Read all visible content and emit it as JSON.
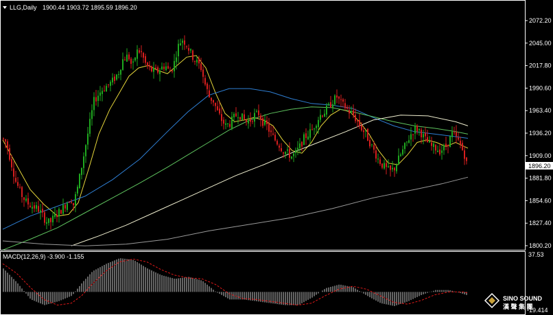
{
  "header": {
    "triangle_icon": "dropdown-triangle-icon",
    "symbol": "LLG,Daily",
    "ohlc": "1900.44 1903.72 1895.59 1896.20"
  },
  "macd_header": "MACD(12,26,9) -3.900 -1.155",
  "price_axis": {
    "ticks": [
      "2072.20",
      "2045.00",
      "2017.80",
      "1990.60",
      "1963.40",
      "1936.20",
      "1909.00",
      "1881.80",
      "1854.60",
      "1827.40",
      "1800.20"
    ],
    "tick_values": [
      2072.2,
      2045.0,
      2017.8,
      1990.6,
      1963.4,
      1936.2,
      1909.0,
      1881.8,
      1854.6,
      1827.4,
      1800.2
    ],
    "current_price": "1896.20",
    "current_value": 1896.2
  },
  "macd_axis": {
    "top": "37.53",
    "bottom": "-19.414",
    "top_value": 37.53,
    "bottom_value": -19.414
  },
  "watermark": {
    "line1": "SINO SOUND",
    "line2": "漢 聲 集 團"
  },
  "colors": {
    "background": "#000000",
    "bull": "#1fa91f",
    "bear": "#d51e1e",
    "ma_fast": "#e6d63a",
    "ma_blue": "#2f7fd4",
    "ma_green": "#5fc45f",
    "ma_white": "#f0efd0",
    "ma_gray": "#9a9a9a",
    "macd_hist": "#c8c8c8",
    "macd_signal": "#e01818",
    "grid_line": "#ffffff"
  },
  "chart_data": {
    "type": "candlestick",
    "symbol": "LLG",
    "timeframe": "Daily",
    "ylim": [
      1800.2,
      2072.2
    ],
    "waypoints": [
      [
        0,
        1930
      ],
      [
        6,
        1925
      ],
      [
        12,
        1905
      ],
      [
        20,
        1878
      ],
      [
        28,
        1862
      ],
      [
        36,
        1852
      ],
      [
        44,
        1848
      ],
      [
        52,
        1845
      ],
      [
        58,
        1838
      ],
      [
        64,
        1830
      ],
      [
        70,
        1828
      ],
      [
        76,
        1835
      ],
      [
        82,
        1840
      ],
      [
        88,
        1845
      ],
      [
        94,
        1852
      ],
      [
        100,
        1858
      ],
      [
        104,
        1850
      ],
      [
        110,
        1870
      ],
      [
        118,
        1905
      ],
      [
        126,
        1940
      ],
      [
        134,
        1975
      ],
      [
        142,
        1985
      ],
      [
        150,
        1992
      ],
      [
        156,
        1995
      ],
      [
        162,
        2000
      ],
      [
        170,
        2010
      ],
      [
        176,
        2025
      ],
      [
        184,
        2030
      ],
      [
        190,
        2015
      ],
      [
        196,
        2035
      ],
      [
        202,
        2035
      ],
      [
        210,
        2018
      ],
      [
        218,
        2012
      ],
      [
        226,
        2010
      ],
      [
        232,
        2015
      ],
      [
        238,
        2018
      ],
      [
        244,
        2010
      ],
      [
        250,
        2018
      ],
      [
        256,
        2040
      ],
      [
        262,
        2050
      ],
      [
        268,
        2045
      ],
      [
        274,
        2035
      ],
      [
        280,
        2025
      ],
      [
        286,
        2020
      ],
      [
        290,
        2015
      ],
      [
        296,
        1995
      ],
      [
        302,
        1980
      ],
      [
        308,
        1975
      ],
      [
        314,
        1962
      ],
      [
        320,
        1952
      ],
      [
        326,
        1945
      ],
      [
        332,
        1948
      ],
      [
        338,
        1955
      ],
      [
        344,
        1960
      ],
      [
        350,
        1955
      ],
      [
        356,
        1950
      ],
      [
        362,
        1952
      ],
      [
        368,
        1958
      ],
      [
        374,
        1960
      ],
      [
        380,
        1950
      ],
      [
        386,
        1945
      ],
      [
        392,
        1935
      ],
      [
        398,
        1928
      ],
      [
        404,
        1922
      ],
      [
        410,
        1915
      ],
      [
        416,
        1912
      ],
      [
        422,
        1908
      ],
      [
        428,
        1912
      ],
      [
        434,
        1920
      ],
      [
        440,
        1930
      ],
      [
        446,
        1935
      ],
      [
        452,
        1940
      ],
      [
        458,
        1950
      ],
      [
        464,
        1958
      ],
      [
        470,
        1962
      ],
      [
        476,
        1968
      ],
      [
        482,
        1975
      ],
      [
        488,
        1980
      ],
      [
        494,
        1972
      ],
      [
        500,
        1968
      ],
      [
        506,
        1962
      ],
      [
        512,
        1958
      ],
      [
        518,
        1950
      ],
      [
        524,
        1942
      ],
      [
        530,
        1935
      ],
      [
        536,
        1925
      ],
      [
        542,
        1915
      ],
      [
        548,
        1905
      ],
      [
        554,
        1898
      ],
      [
        560,
        1893
      ],
      [
        566,
        1890
      ],
      [
        572,
        1894
      ],
      [
        578,
        1905
      ],
      [
        584,
        1915
      ],
      [
        590,
        1925
      ],
      [
        596,
        1935
      ],
      [
        602,
        1942
      ],
      [
        608,
        1940
      ],
      [
        614,
        1932
      ],
      [
        620,
        1925
      ],
      [
        626,
        1920
      ],
      [
        632,
        1918
      ],
      [
        638,
        1915
      ],
      [
        644,
        1918
      ],
      [
        650,
        1925
      ],
      [
        656,
        1935
      ],
      [
        662,
        1930
      ],
      [
        668,
        1922
      ],
      [
        674,
        1910
      ],
      [
        678,
        1896
      ]
    ],
    "moving_averages": [
      {
        "color": "#e6d63a",
        "points": [
          [
            0,
            1928
          ],
          [
            20,
            1898
          ],
          [
            40,
            1868
          ],
          [
            60,
            1850
          ],
          [
            80,
            1836
          ],
          [
            96,
            1838
          ],
          [
            110,
            1852
          ],
          [
            126,
            1895
          ],
          [
            140,
            1935
          ],
          [
            156,
            1965
          ],
          [
            170,
            1985
          ],
          [
            184,
            2005
          ],
          [
            198,
            2015
          ],
          [
            212,
            2018
          ],
          [
            226,
            2012
          ],
          [
            240,
            2008
          ],
          [
            254,
            2018
          ],
          [
            268,
            2028
          ],
          [
            282,
            2030
          ],
          [
            296,
            2015
          ],
          [
            310,
            1985
          ],
          [
            324,
            1960
          ],
          [
            338,
            1950
          ],
          [
            352,
            1952
          ],
          [
            366,
            1955
          ],
          [
            380,
            1952
          ],
          [
            394,
            1945
          ],
          [
            408,
            1928
          ],
          [
            422,
            1915
          ],
          [
            436,
            1912
          ],
          [
            450,
            1925
          ],
          [
            464,
            1945
          ],
          [
            478,
            1958
          ],
          [
            492,
            1965
          ],
          [
            506,
            1962
          ],
          [
            520,
            1950
          ],
          [
            534,
            1935
          ],
          [
            548,
            1915
          ],
          [
            562,
            1900
          ],
          [
            576,
            1898
          ],
          [
            590,
            1910
          ],
          [
            604,
            1925
          ],
          [
            618,
            1928
          ],
          [
            632,
            1925
          ],
          [
            646,
            1920
          ],
          [
            660,
            1925
          ],
          [
            678,
            1918
          ]
        ]
      },
      {
        "color": "#2f7fd4",
        "points": [
          [
            0,
            1820
          ],
          [
            40,
            1836
          ],
          [
            80,
            1848
          ],
          [
            120,
            1860
          ],
          [
            160,
            1880
          ],
          [
            200,
            1905
          ],
          [
            240,
            1938
          ],
          [
            270,
            1962
          ],
          [
            300,
            1982
          ],
          [
            330,
            1990
          ],
          [
            360,
            1990
          ],
          [
            390,
            1986
          ],
          [
            420,
            1978
          ],
          [
            450,
            1972
          ],
          [
            480,
            1970
          ],
          [
            510,
            1966
          ],
          [
            540,
            1955
          ],
          [
            570,
            1945
          ],
          [
            600,
            1938
          ],
          [
            630,
            1935
          ],
          [
            660,
            1932
          ],
          [
            678,
            1930
          ]
        ]
      },
      {
        "color": "#5fc45f",
        "points": [
          [
            0,
            1795
          ],
          [
            40,
            1808
          ],
          [
            80,
            1822
          ],
          [
            120,
            1840
          ],
          [
            160,
            1858
          ],
          [
            200,
            1876
          ],
          [
            240,
            1895
          ],
          [
            270,
            1910
          ],
          [
            300,
            1925
          ],
          [
            330,
            1940
          ],
          [
            360,
            1952
          ],
          [
            390,
            1960
          ],
          [
            420,
            1965
          ],
          [
            450,
            1968
          ],
          [
            480,
            1967
          ],
          [
            510,
            1962
          ],
          [
            540,
            1956
          ],
          [
            570,
            1950
          ],
          [
            600,
            1945
          ],
          [
            630,
            1942
          ],
          [
            660,
            1938
          ],
          [
            678,
            1935
          ]
        ]
      },
      {
        "color": "#f0efd0",
        "points": [
          [
            100,
            1800
          ],
          [
            140,
            1812
          ],
          [
            180,
            1825
          ],
          [
            220,
            1840
          ],
          [
            260,
            1855
          ],
          [
            300,
            1870
          ],
          [
            340,
            1885
          ],
          [
            380,
            1898
          ],
          [
            420,
            1912
          ],
          [
            460,
            1925
          ],
          [
            500,
            1938
          ],
          [
            540,
            1952
          ],
          [
            580,
            1958
          ],
          [
            620,
            1957
          ],
          [
            660,
            1950
          ],
          [
            678,
            1945
          ]
        ]
      },
      {
        "color": "#9a9a9a",
        "points": [
          [
            0,
            1806
          ],
          [
            60,
            1802
          ],
          [
            120,
            1800
          ],
          [
            180,
            1802
          ],
          [
            240,
            1808
          ],
          [
            300,
            1818
          ],
          [
            360,
            1826
          ],
          [
            420,
            1834
          ],
          [
            480,
            1845
          ],
          [
            540,
            1858
          ],
          [
            600,
            1868
          ],
          [
            640,
            1875
          ],
          [
            678,
            1883
          ]
        ]
      }
    ],
    "macd": {
      "hist_waypoints": [
        [
          0,
          25
        ],
        [
          20,
          10
        ],
        [
          40,
          -8
        ],
        [
          60,
          -14
        ],
        [
          80,
          -10
        ],
        [
          100,
          -4
        ],
        [
          115,
          10
        ],
        [
          130,
          22
        ],
        [
          150,
          30
        ],
        [
          170,
          36
        ],
        [
          190,
          34
        ],
        [
          210,
          25
        ],
        [
          230,
          18
        ],
        [
          250,
          14
        ],
        [
          270,
          16
        ],
        [
          290,
          12
        ],
        [
          310,
          0
        ],
        [
          330,
          -8
        ],
        [
          350,
          -8
        ],
        [
          370,
          -10
        ],
        [
          390,
          -12
        ],
        [
          410,
          -14
        ],
        [
          430,
          -14
        ],
        [
          450,
          -6
        ],
        [
          470,
          4
        ],
        [
          490,
          8
        ],
        [
          510,
          5
        ],
        [
          530,
          -4
        ],
        [
          550,
          -12
        ],
        [
          570,
          -15
        ],
        [
          590,
          -10
        ],
        [
          610,
          -3
        ],
        [
          630,
          2
        ],
        [
          650,
          2
        ],
        [
          670,
          -2
        ],
        [
          678,
          -4
        ]
      ],
      "signal_waypoints": [
        [
          0,
          30
        ],
        [
          20,
          20
        ],
        [
          40,
          5
        ],
        [
          60,
          -8
        ],
        [
          80,
          -14
        ],
        [
          100,
          -12
        ],
        [
          115,
          -4
        ],
        [
          130,
          8
        ],
        [
          150,
          22
        ],
        [
          170,
          32
        ],
        [
          190,
          35
        ],
        [
          210,
          32
        ],
        [
          230,
          24
        ],
        [
          250,
          18
        ],
        [
          270,
          15
        ],
        [
          290,
          14
        ],
        [
          310,
          8
        ],
        [
          330,
          -2
        ],
        [
          350,
          -7
        ],
        [
          370,
          -8
        ],
        [
          390,
          -10
        ],
        [
          410,
          -12
        ],
        [
          430,
          -14
        ],
        [
          450,
          -12
        ],
        [
          470,
          -4
        ],
        [
          490,
          3
        ],
        [
          510,
          6
        ],
        [
          530,
          3
        ],
        [
          550,
          -4
        ],
        [
          570,
          -11
        ],
        [
          590,
          -13
        ],
        [
          610,
          -9
        ],
        [
          630,
          -3
        ],
        [
          650,
          0
        ],
        [
          670,
          0
        ],
        [
          678,
          -1
        ]
      ]
    }
  }
}
